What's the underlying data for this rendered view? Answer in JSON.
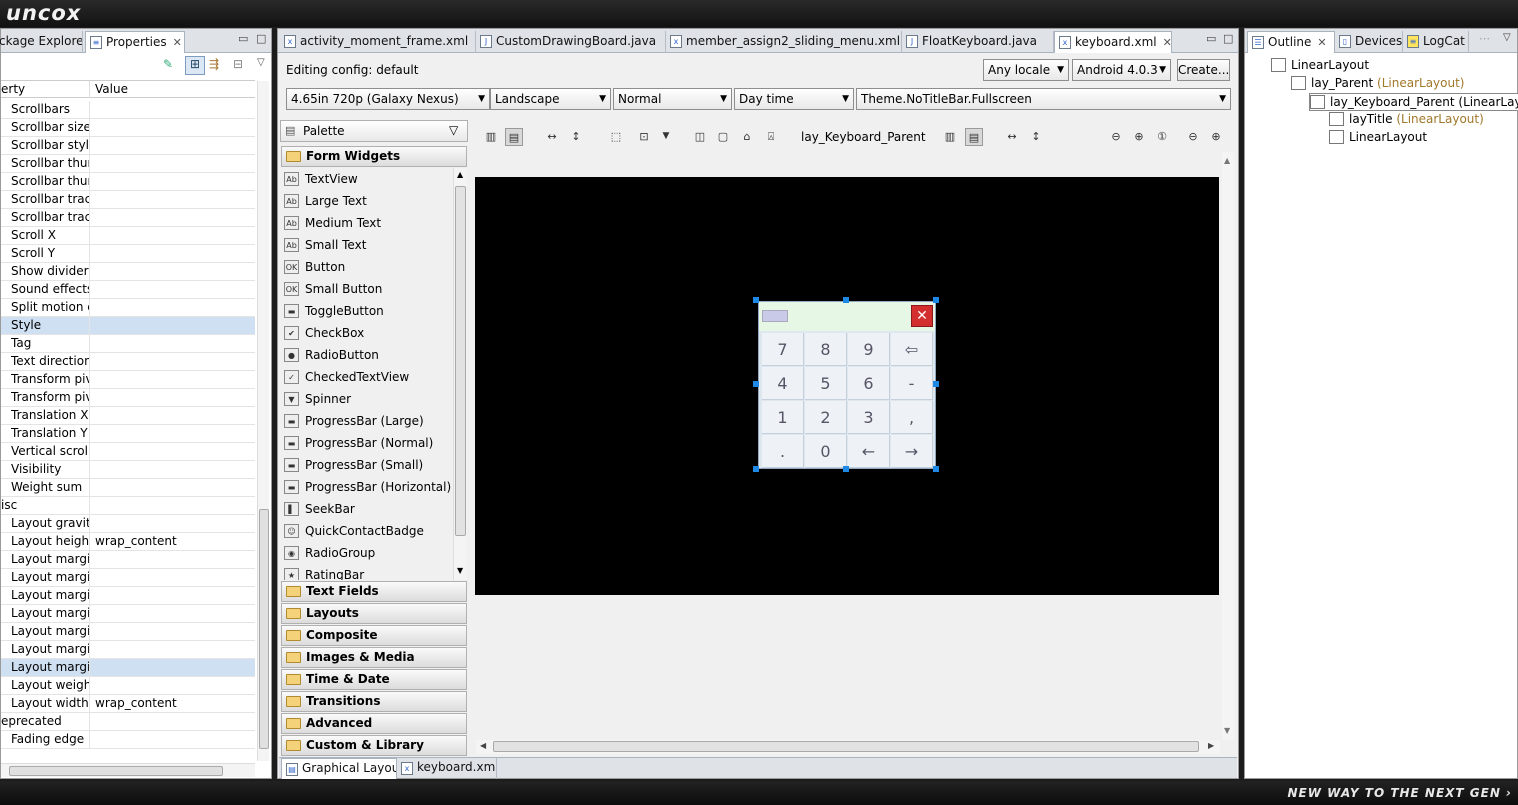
{
  "topbar": {
    "logo": "uncox"
  },
  "bottombar": {
    "slogan": "NEW WAY TO THE NEXT GEN ›"
  },
  "left_panel": {
    "tabs": [
      {
        "label": "ckage Explorer"
      },
      {
        "label": "Properties"
      }
    ],
    "columns": {
      "property": "erty",
      "value": "Value"
    },
    "rows": [
      {
        "name": "Scrollbars",
        "value": ""
      },
      {
        "name": "Scrollbar size",
        "value": ""
      },
      {
        "name": "Scrollbar style",
        "value": ""
      },
      {
        "name": "Scrollbar thum",
        "value": ""
      },
      {
        "name": "Scrollbar thum",
        "value": ""
      },
      {
        "name": "Scrollbar track",
        "value": ""
      },
      {
        "name": "Scrollbar track",
        "value": ""
      },
      {
        "name": "Scroll X",
        "value": ""
      },
      {
        "name": "Scroll Y",
        "value": ""
      },
      {
        "name": "Show dividers",
        "value": ""
      },
      {
        "name": "Sound effects e",
        "value": ""
      },
      {
        "name": "Split motion ev",
        "value": ""
      },
      {
        "name": "Style",
        "value": ""
      },
      {
        "name": "Tag",
        "value": ""
      },
      {
        "name": "Text direction",
        "value": ""
      },
      {
        "name": "Transform pivo",
        "value": ""
      },
      {
        "name": "Transform pivo",
        "value": ""
      },
      {
        "name": "Translation X",
        "value": ""
      },
      {
        "name": "Translation Y",
        "value": ""
      },
      {
        "name": "Vertical scrollb",
        "value": ""
      },
      {
        "name": "Visibility",
        "value": ""
      },
      {
        "name": "Weight sum",
        "value": ""
      },
      {
        "name": "isc",
        "value": ""
      },
      {
        "name": "Layout gravity",
        "value": ""
      },
      {
        "name": "Layout height",
        "value": "wrap_content"
      },
      {
        "name": "Layout margin",
        "value": ""
      },
      {
        "name": "Layout margin",
        "value": ""
      },
      {
        "name": "Layout margin",
        "value": ""
      },
      {
        "name": "Layout margin",
        "value": ""
      },
      {
        "name": "Layout margin",
        "value": ""
      },
      {
        "name": "Layout margin",
        "value": ""
      },
      {
        "name": "Layout margin",
        "value": ""
      },
      {
        "name": "Layout weight",
        "value": ""
      },
      {
        "name": "Layout width",
        "value": "wrap_content"
      },
      {
        "name": "eprecated",
        "value": ""
      },
      {
        "name": "Fading edge",
        "value": ""
      }
    ]
  },
  "editor": {
    "tabs": [
      {
        "label": "activity_moment_frame.xml"
      },
      {
        "label": "CustomDrawingBoard.java"
      },
      {
        "label": "member_assign2_sliding_menu.xml"
      },
      {
        "label": "FloatKeyboard.java"
      },
      {
        "label": "keyboard.xml"
      }
    ],
    "editing_config": "Editing config:  default",
    "locale": "Any locale",
    "api": "Android 4.0.3",
    "create_button": "Create...",
    "device": "4.65in 720p (Galaxy Nexus)",
    "orientation": "Landscape",
    "mode": "Normal",
    "time": "Day time",
    "theme": "Theme.NoTitleBar.Fullscreen",
    "selected_view": "lay_Keyboard_Parent",
    "bottom_tabs": [
      {
        "label": "Graphical Layout"
      },
      {
        "label": "keyboard.xml"
      }
    ]
  },
  "palette": {
    "title": "Palette",
    "open_category": "Form Widgets",
    "items": [
      {
        "label": "TextView",
        "icon": "Ab"
      },
      {
        "label": "Large Text",
        "icon": "Ab"
      },
      {
        "label": "Medium Text",
        "icon": "Ab"
      },
      {
        "label": "Small Text",
        "icon": "Ab"
      },
      {
        "label": "Button",
        "icon": "OK"
      },
      {
        "label": "Small Button",
        "icon": "OK"
      },
      {
        "label": "ToggleButton",
        "icon": "▬"
      },
      {
        "label": "CheckBox",
        "icon": "✔"
      },
      {
        "label": "RadioButton",
        "icon": "●"
      },
      {
        "label": "CheckedTextView",
        "icon": "✓"
      },
      {
        "label": "Spinner",
        "icon": "▼"
      },
      {
        "label": "ProgressBar (Large)",
        "icon": "▬"
      },
      {
        "label": "ProgressBar (Normal)",
        "icon": "▬"
      },
      {
        "label": "ProgressBar (Small)",
        "icon": "▬"
      },
      {
        "label": "ProgressBar (Horizontal)",
        "icon": "▬"
      },
      {
        "label": "SeekBar",
        "icon": "▌"
      },
      {
        "label": "QuickContactBadge",
        "icon": "☺"
      },
      {
        "label": "RadioGroup",
        "icon": "◉"
      },
      {
        "label": "RatingBar",
        "icon": "★"
      }
    ],
    "categories": [
      {
        "label": "Text Fields"
      },
      {
        "label": "Layouts"
      },
      {
        "label": "Composite"
      },
      {
        "label": "Images & Media"
      },
      {
        "label": "Time & Date"
      },
      {
        "label": "Transitions"
      },
      {
        "label": "Advanced"
      },
      {
        "label": "Custom & Library Views"
      }
    ]
  },
  "keyboard": {
    "keys": [
      "7",
      "8",
      "9",
      "⇦",
      "4",
      "5",
      "6",
      "-",
      "1",
      "2",
      "3",
      ",",
      ".",
      "0",
      "←",
      "→"
    ],
    "close_icon": "close-icon"
  },
  "right_panel": {
    "tabs": [
      {
        "label": "Outline"
      },
      {
        "label": "Devices"
      },
      {
        "label": "LogCat"
      }
    ],
    "tree": [
      {
        "name": "LinearLayout",
        "type": ""
      },
      {
        "name": "lay_Parent ",
        "type": "(LinearLayout)"
      },
      {
        "name": "lay_Keyboard_Parent (LinearLayout)",
        "type": ""
      },
      {
        "name": "layTitle ",
        "type": "(LinearLayout)"
      },
      {
        "name": "LinearLayout",
        "type": ""
      }
    ]
  },
  "colors": {
    "canvas": "#000000",
    "keyboard_title": "#e6f7e6",
    "close": "#d32f2f",
    "accent": "#1e88e5"
  }
}
